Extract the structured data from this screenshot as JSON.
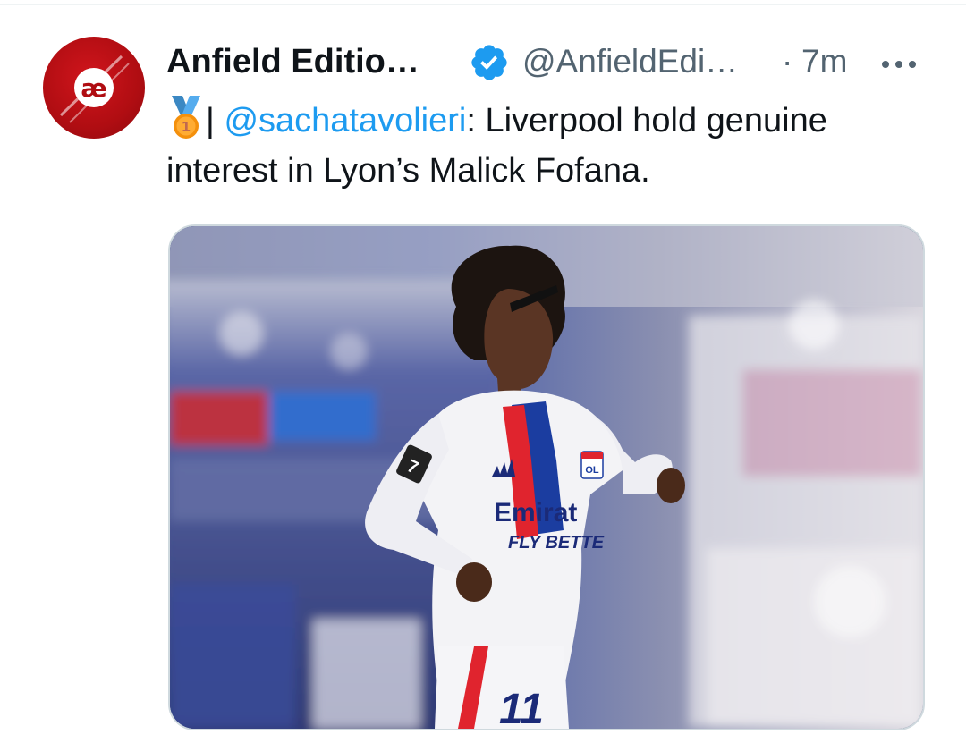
{
  "tweet": {
    "author": {
      "display_name": "Anfield Editio…",
      "handle": "@AnfieldEdi…",
      "verified": true,
      "avatar_text": "æ",
      "avatar_color": "#c1121a"
    },
    "separator": "·",
    "timestamp": "7m",
    "text": {
      "medal_icon": "first-place-medal-icon",
      "pipe": "|",
      "mention": "@sachatavolieri",
      "body": ": Liverpool hold genuine interest in Lyon’s Malick Fofana."
    },
    "media": {
      "shirt_sponsor_line1": "Emirat",
      "shirt_sponsor_line2": "FLY BETTE",
      "shirt_number": "11",
      "sleeve_number": "7",
      "crest_text": "OL"
    }
  },
  "colors": {
    "link": "#1d9bf0",
    "secondary_text": "#536471",
    "verified": "#1d9bf0",
    "text": "#0f1419"
  }
}
